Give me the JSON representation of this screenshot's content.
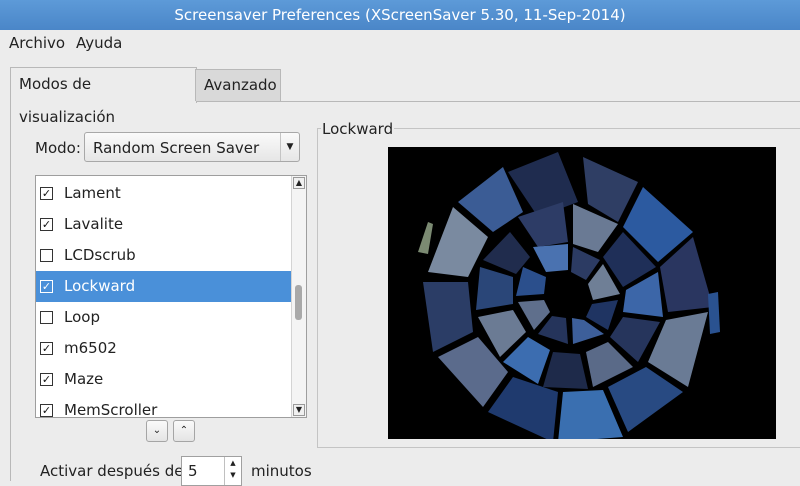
{
  "window": {
    "title": "Screensaver Preferences  (XScreenSaver 5.30, 11-Sep-2014)"
  },
  "menu": [
    {
      "label": "Archivo"
    },
    {
      "label": "Ayuda"
    }
  ],
  "tabs": [
    {
      "label": "Modos de visualización",
      "active": true
    },
    {
      "label": "Avanzado",
      "active": false
    }
  ],
  "mode": {
    "label": "Modo:",
    "value": "Random Screen Saver"
  },
  "savers": [
    {
      "label": "Lament",
      "checked": true
    },
    {
      "label": "Lavalite",
      "checked": true
    },
    {
      "label": "LCDscrub",
      "checked": false
    },
    {
      "label": "Lockward",
      "checked": true,
      "selected": true
    },
    {
      "label": "Loop",
      "checked": false
    },
    {
      "label": "m6502",
      "checked": true
    },
    {
      "label": "Maze",
      "checked": true
    },
    {
      "label": "MemScroller",
      "checked": true
    }
  ],
  "preview": {
    "title": "Lockward"
  },
  "activate": {
    "label": "Activar después de",
    "value": "5",
    "unit": "minutos"
  },
  "colors": {
    "accent": "#4a90d9",
    "titlebar": "#4a86c8"
  }
}
